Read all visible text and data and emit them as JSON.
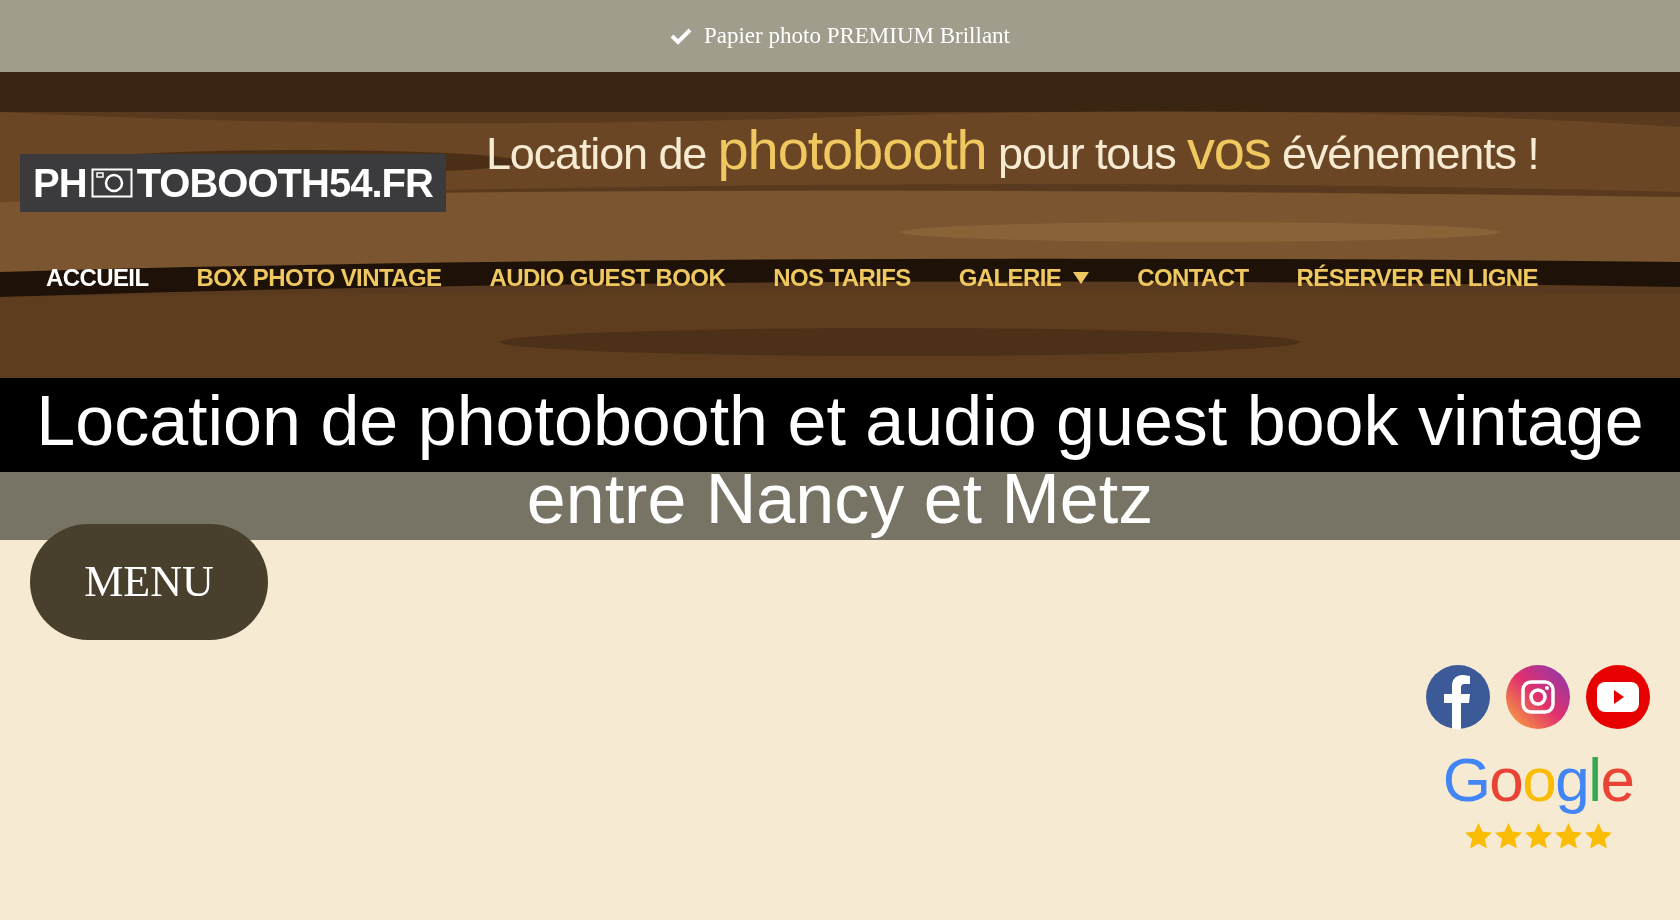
{
  "top_bar": {
    "text": "Papier photo PREMIUM Brillant"
  },
  "logo": {
    "before": "PH",
    "after": "TOBOOTH54.FR"
  },
  "tagline": [
    {
      "text": "Location de ",
      "highlight": false
    },
    {
      "text": "photobooth",
      "highlight": true
    },
    {
      "text": " pour tous ",
      "highlight": false
    },
    {
      "text": "vos",
      "highlight": true
    },
    {
      "text": " événements !",
      "highlight": false
    }
  ],
  "nav": [
    {
      "label": "ACCUEIL",
      "selected": true,
      "has_submenu": false
    },
    {
      "label": "BOX PHOTO VINTAGE",
      "selected": false,
      "has_submenu": false
    },
    {
      "label": "AUDIO GUEST BOOK",
      "selected": false,
      "has_submenu": false
    },
    {
      "label": "NOS TARIFS",
      "selected": false,
      "has_submenu": false
    },
    {
      "label": "GALERIE",
      "selected": false,
      "has_submenu": true
    },
    {
      "label": "CONTACT",
      "selected": false,
      "has_submenu": false
    },
    {
      "label": "RÉSERVER EN LIGNE",
      "selected": false,
      "has_submenu": false
    }
  ],
  "page_title": "Location de photobooth et audio guest book vintage entre Nancy et Metz",
  "menu_button": "MENU",
  "social": [
    {
      "kind": "facebook"
    },
    {
      "kind": "instagram"
    },
    {
      "kind": "youtube"
    }
  ],
  "google_rating": {
    "logo": "Google",
    "stars": 5
  }
}
